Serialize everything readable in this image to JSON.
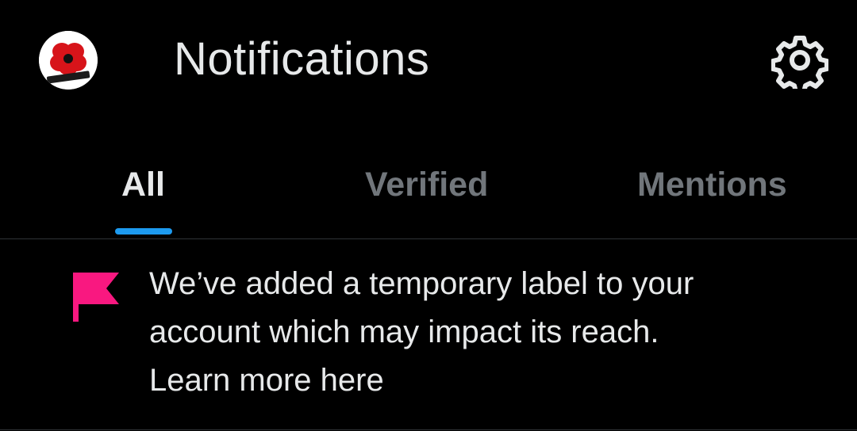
{
  "header": {
    "title": "Notifications",
    "avatar_icon": "poppy-avatar-icon",
    "settings_icon": "gear-icon"
  },
  "tabs": [
    {
      "label": "All",
      "selected": true
    },
    {
      "label": "Verified",
      "selected": false
    },
    {
      "label": "Mentions",
      "selected": false
    }
  ],
  "notice": {
    "icon": "flag-icon",
    "line1": "We’ve added a temporary label to your",
    "line2": "account which may impact its reach.",
    "link_text": "Learn more here"
  },
  "colors": {
    "background": "#000000",
    "text_primary": "#e7e9ea",
    "text_secondary": "#71767b",
    "accent": "#1d9bf0",
    "flag": "#f91880",
    "divider": "#2f3336"
  }
}
